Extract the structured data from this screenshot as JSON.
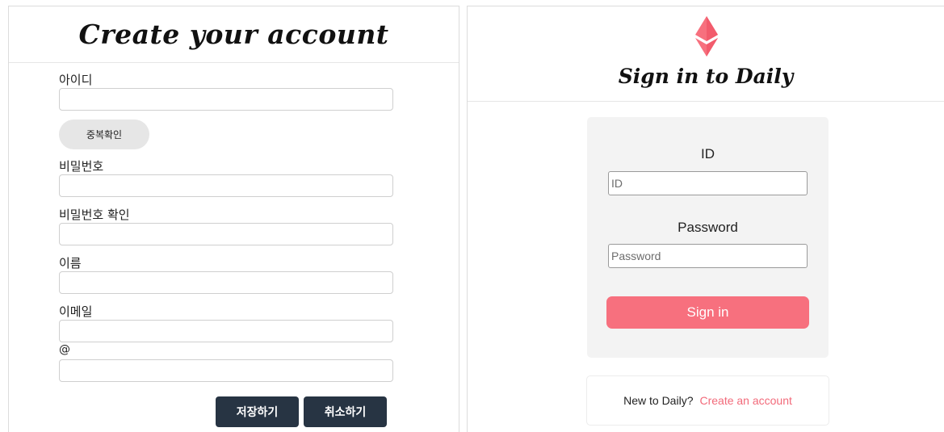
{
  "signup": {
    "title": "Create your account",
    "labels": {
      "id": "아이디",
      "password": "비밀번호",
      "password_confirm": "비밀번호 확인",
      "name": "이름",
      "email": "이메일",
      "email_at": "@"
    },
    "values": {
      "id": "",
      "password": "",
      "password_confirm": "",
      "name": "",
      "email_local": "",
      "email_domain": ""
    },
    "duplicate_check_label": "중복확인",
    "save_label": "저장하기",
    "cancel_label": "취소하기"
  },
  "signin": {
    "logo_icon": "ethereum-diamond-icon",
    "title": "Sign in to Daily",
    "id_label": "ID",
    "id_placeholder": "ID",
    "password_label": "Password",
    "password_placeholder": "Password",
    "signin_label": "Sign in",
    "new_text": "New to Daily?",
    "create_link": "Create an account"
  },
  "colors": {
    "accent_pink": "#f7707e",
    "dark_button": "#273443",
    "box_gray": "#f3f3f3"
  }
}
